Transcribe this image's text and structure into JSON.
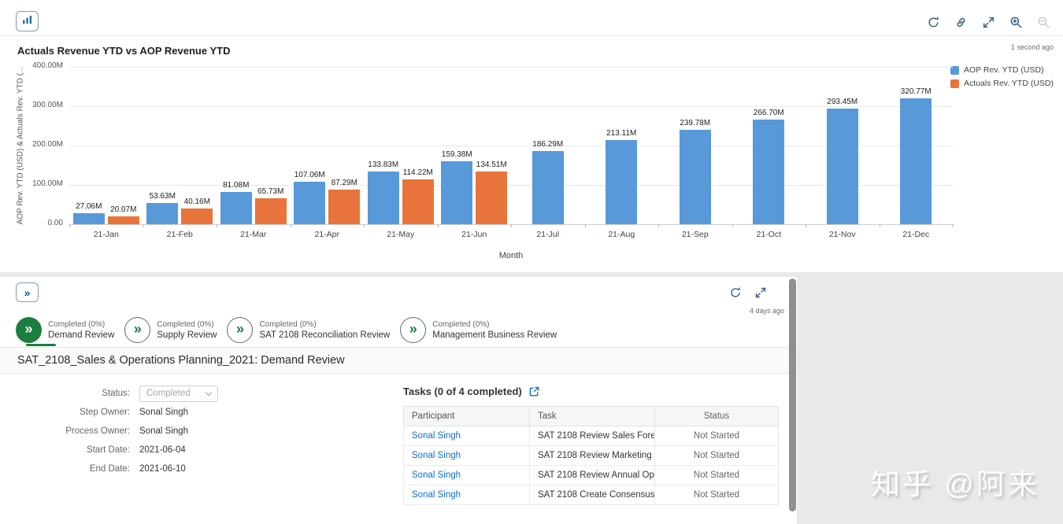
{
  "toolbar": {
    "icons": [
      "bar-chart",
      "refresh",
      "link",
      "expand",
      "zoom-in",
      "zoom-out"
    ]
  },
  "chart_panel": {
    "title": "Actuals Revenue YTD vs AOP Revenue YTD",
    "updated": "1 second ago",
    "legend": [
      {
        "label": "AOP Rev. YTD (USD)",
        "color": "#5899DA"
      },
      {
        "label": "Actuals Rev. YTD (USD)",
        "color": "#E8743B"
      }
    ],
    "y_axis_label": "AOP Rev. YTD (USD) & Actuals Rev. YTD (...",
    "x_axis_label": "Month"
  },
  "chart_data": {
    "type": "bar",
    "title": "Actuals Revenue YTD vs AOP Revenue YTD",
    "categories": [
      "21-Jan",
      "21-Feb",
      "21-Mar",
      "21-Apr",
      "21-May",
      "21-Jun",
      "21-Jul",
      "21-Aug",
      "21-Sep",
      "21-Oct",
      "21-Nov",
      "21-Dec"
    ],
    "series": [
      {
        "name": "AOP Rev. YTD (USD)",
        "color": "#5899DA",
        "values": [
          27.06,
          53.63,
          81.08,
          107.06,
          133.83,
          159.38,
          186.29,
          213.11,
          239.78,
          266.7,
          293.45,
          320.77
        ]
      },
      {
        "name": "Actuals Rev. YTD (USD)",
        "color": "#E8743B",
        "values": [
          20.07,
          40.16,
          65.73,
          87.29,
          114.22,
          134.51,
          null,
          null,
          null,
          null,
          null,
          null
        ]
      }
    ],
    "unit": "M",
    "xlabel": "Month",
    "ylabel": "AOP Rev. YTD (USD) & Actuals Rev. YTD (...",
    "ylim": [
      0,
      400
    ],
    "yticks": [
      "400.00M",
      "300.00M",
      "200.00M",
      "100.00M",
      "0.00"
    ],
    "grid": true,
    "legend_position": "top-right"
  },
  "process_panel": {
    "updated": "4 days ago",
    "steps": [
      {
        "completed": "Completed (0%)",
        "name": "Demand Review",
        "active": true
      },
      {
        "completed": "Completed (0%)",
        "name": "Supply Review",
        "active": false
      },
      {
        "completed": "Completed (0%)",
        "name": "SAT 2108 Reconciliation Review",
        "active": false
      },
      {
        "completed": "Completed (0%)",
        "name": "Management Business Review",
        "active": false
      }
    ],
    "section_title": "SAT_2108_Sales & Operations Planning_2021: Demand Review",
    "details": {
      "status_label": "Status:",
      "status_value": "Completed",
      "step_owner_label": "Step Owner:",
      "step_owner_value": "Sonal Singh",
      "process_owner_label": "Process Owner:",
      "process_owner_value": "Sonal Singh",
      "start_date_label": "Start Date:",
      "start_date_value": "2021-06-04",
      "end_date_label": "End Date:",
      "end_date_value": "2021-06-10"
    },
    "tasks": {
      "title": "Tasks (0 of 4 completed)",
      "columns": [
        "Participant",
        "Task",
        "Status"
      ],
      "rows": [
        {
          "participant": "Sonal Singh",
          "task": "SAT 2108 Review Sales Fore...",
          "status": "Not Started"
        },
        {
          "participant": "Sonal Singh",
          "task": "SAT 2108 Review Marketing ...",
          "status": "Not Started"
        },
        {
          "participant": "Sonal Singh",
          "task": "SAT 2108 Review Annual Op...",
          "status": "Not Started"
        },
        {
          "participant": "Sonal Singh",
          "task": "SAT 2108 Create Consensus ...",
          "status": "Not Started"
        }
      ]
    }
  },
  "watermark": "知乎 @阿来"
}
